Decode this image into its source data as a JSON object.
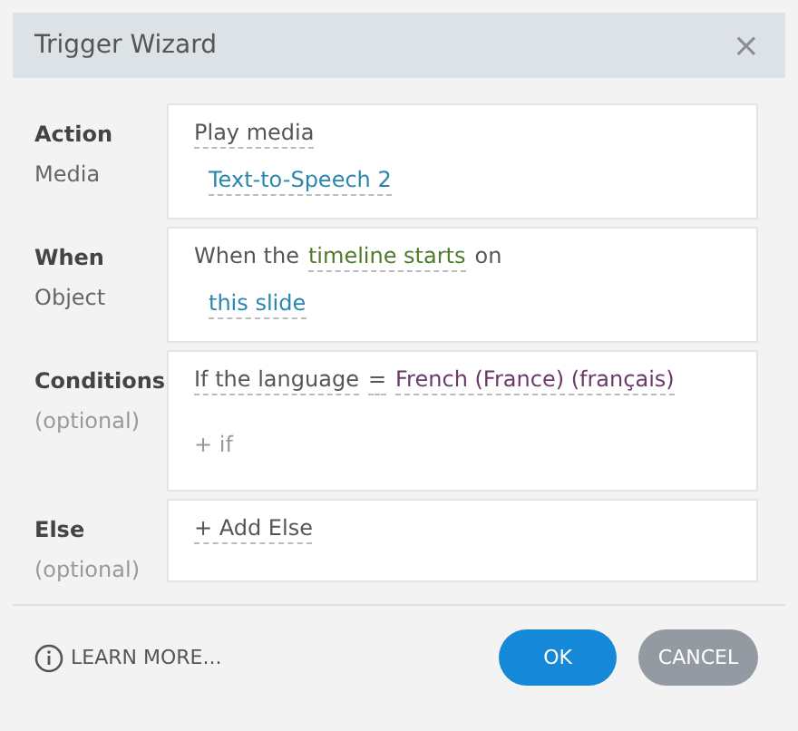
{
  "window": {
    "title": "Trigger Wizard",
    "close": "×"
  },
  "sections": [
    {
      "labels": [
        {
          "text": "Action",
          "kind": "title"
        },
        {
          "text": "Media",
          "kind": "field"
        }
      ],
      "lines": [
        [
          {
            "text": "Play media",
            "kind": "option"
          }
        ],
        [
          {
            "text": "Text-to-Speech 2",
            "kind": "object"
          }
        ]
      ]
    },
    {
      "labels": [
        {
          "text": "When",
          "kind": "title"
        },
        {
          "text": "Object",
          "kind": "field"
        }
      ],
      "lines": [
        [
          {
            "text": "When the",
            "kind": "text"
          },
          {
            "text": "timeline starts",
            "kind": "event"
          },
          {
            "text": "on",
            "kind": "text"
          }
        ],
        [
          {
            "text": "this slide",
            "kind": "object"
          }
        ]
      ]
    },
    {
      "labels": [
        {
          "text": "Conditions",
          "kind": "title"
        },
        {
          "text": "(optional)",
          "kind": "note"
        }
      ],
      "lines": [
        [
          {
            "text": "If the language",
            "kind": "option"
          },
          {
            "text": "=",
            "kind": "option"
          },
          {
            "text": "French (France) (français)",
            "kind": "value"
          }
        ],
        [
          {
            "text": "+ if",
            "kind": "add"
          }
        ]
      ]
    },
    {
      "labels": [
        {
          "text": "Else",
          "kind": "title"
        },
        {
          "text": "(optional)",
          "kind": "note"
        }
      ],
      "lines": [
        [
          {
            "text": "+ Add Else",
            "kind": "option"
          }
        ]
      ]
    }
  ],
  "footer": {
    "link": "LEARN MORE...",
    "buttons": [
      {
        "label": "OK",
        "kind": "primary"
      },
      {
        "label": "CANCEL",
        "kind": "secondary"
      }
    ]
  }
}
